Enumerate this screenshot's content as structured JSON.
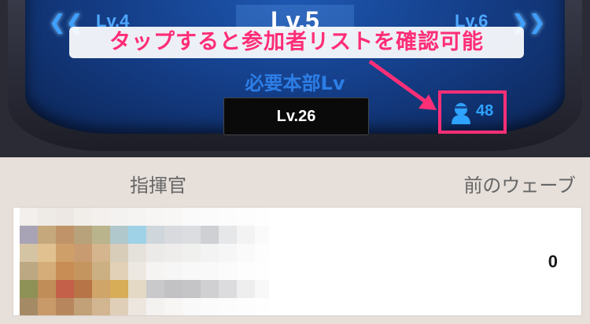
{
  "level_nav": {
    "prev_label": "Lv.4",
    "current_label": "Lv.5",
    "next_label": "Lv.6",
    "left_arrow_icon": "double-chevron-left-icon",
    "right_arrow_icon": "double-chevron-right-icon"
  },
  "requirement": {
    "label": "必要本部Lv",
    "value": "Lv.26"
  },
  "participants": {
    "icon": "person-icon",
    "count": "48"
  },
  "annotation": {
    "text": "タップすると参加者リストを確認可能"
  },
  "table": {
    "columns": [
      "指揮官",
      "前のウェーブ"
    ],
    "rows": [
      {
        "commander": "",
        "previous_wave": "0"
      }
    ]
  },
  "colors": {
    "accent_blue": "#2ea3ff",
    "annotation_pink": "#ff2f77",
    "panel_bg": "#e6dfda"
  }
}
